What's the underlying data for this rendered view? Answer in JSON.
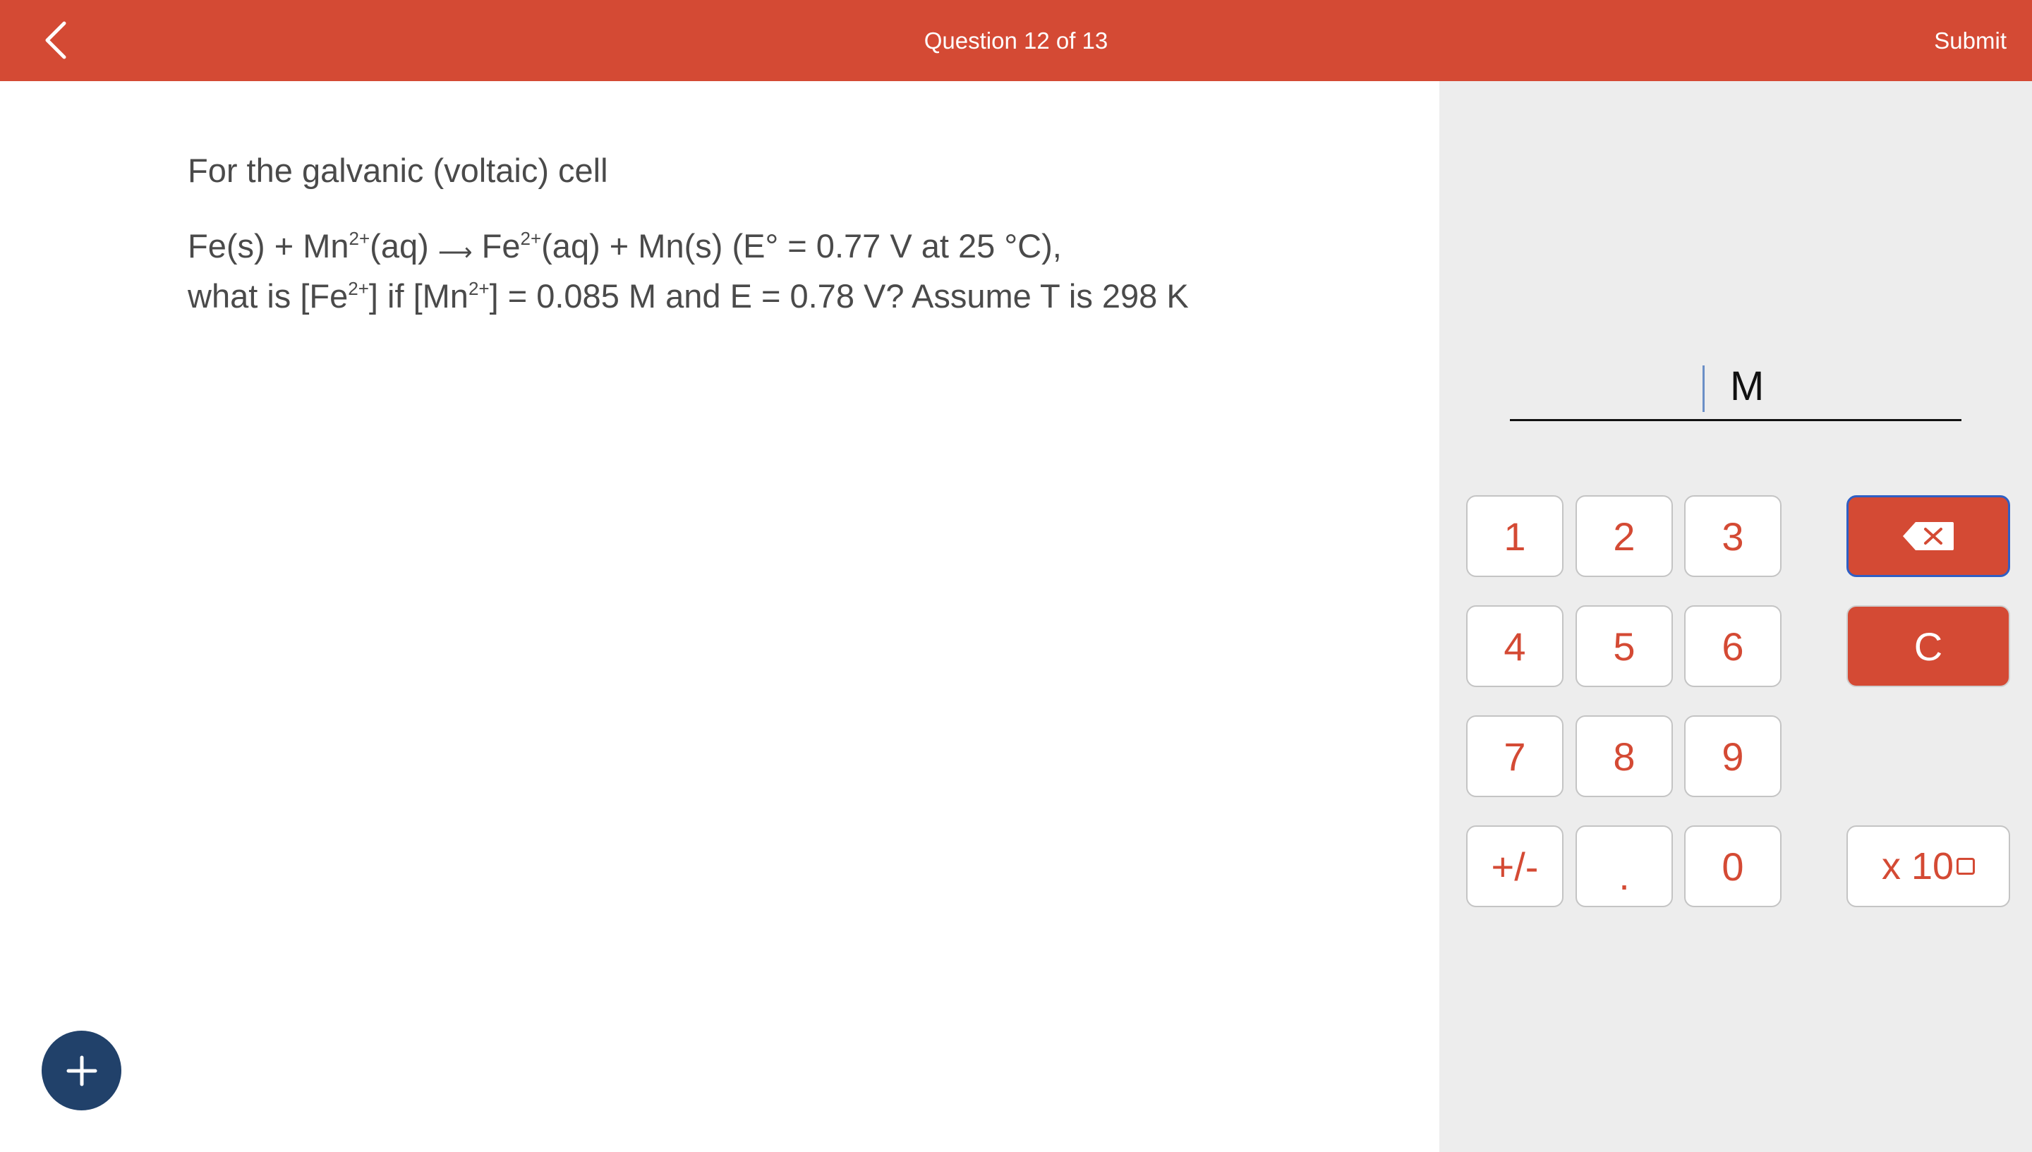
{
  "header": {
    "title": "Question 12 of 13",
    "submit_label": "Submit",
    "back_icon": "chevron-left-icon",
    "background_color": "#d44a34"
  },
  "question": {
    "intro": "For the galvanic (voltaic) cell",
    "eq": {
      "p1": "Fe(s) + Mn",
      "s1": "2+",
      "p2": "(aq)",
      "arrow": "⟶",
      "p3": "Fe",
      "s2": "2+",
      "p4": "(aq) + Mn(s) (E° = 0.77 V at 25 °C),"
    },
    "line2": {
      "p1": "what is [Fe",
      "s1": "2+",
      "p2": "] if [Mn",
      "s2": "2+",
      "p3": "] = 0.085 M and E = 0.78 V? Assume T is 298 K"
    }
  },
  "answer": {
    "value": "",
    "unit": "M"
  },
  "keypad": {
    "keys": [
      "1",
      "2",
      "3",
      "4",
      "5",
      "6",
      "7",
      "8",
      "9",
      "+/-",
      ".",
      "0"
    ],
    "backspace_icon": "backspace-icon",
    "clear_label": "C",
    "exponent_label": "x 10",
    "key_color": "#d44a34"
  },
  "fab": {
    "icon": "plus-icon",
    "color": "#21416a"
  }
}
